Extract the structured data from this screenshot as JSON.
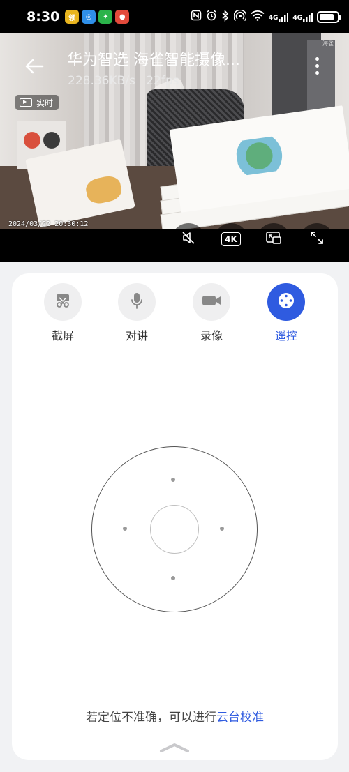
{
  "status_bar": {
    "time": "8:30",
    "apps": [
      {
        "icon": "coupon-app-icon",
        "text": "领",
        "color": "#e9b51f"
      },
      {
        "icon": "browser-app-icon",
        "text": "◎",
        "color": "#2f8fe8"
      },
      {
        "icon": "wechat-icon",
        "text": "✦",
        "color": "#2bb34a"
      },
      {
        "icon": "game-app-icon",
        "text": "●",
        "color": "#e24a3b"
      }
    ],
    "indicators": [
      "nfc-icon",
      "alarm-icon",
      "bluetooth-icon",
      "hotspot-icon",
      "wifi-icon"
    ],
    "sim1": "4G",
    "sim2": "4G",
    "battery_level": 0.85
  },
  "video": {
    "title": "华为智选 海雀智能摄像...",
    "stats": "228.36KB/s 22fps",
    "live_label": "实时",
    "timestamp": "2024/03/22 20:30:12",
    "watermark": "海雀",
    "controls": {
      "mute_icon": "speaker-muted-icon",
      "quality_label": "4K",
      "pip_icon": "picture-in-picture-icon",
      "fullscreen_icon": "fullscreen-icon"
    }
  },
  "toolbar": {
    "tools": [
      {
        "key": "screenshot",
        "label": "截屏",
        "icon": "scissors-icon",
        "active": false
      },
      {
        "key": "talk",
        "label": "对讲",
        "icon": "microphone-icon",
        "active": false
      },
      {
        "key": "record",
        "label": "录像",
        "icon": "video-camera-icon",
        "active": false
      },
      {
        "key": "remote",
        "label": "遥控",
        "icon": "joystick-icon",
        "active": true
      }
    ]
  },
  "hint": {
    "text": "若定位不准确，可以进行",
    "link": "云台校准"
  },
  "colors": {
    "accent": "#2f5be0",
    "page_bg": "#f1f2f4"
  }
}
